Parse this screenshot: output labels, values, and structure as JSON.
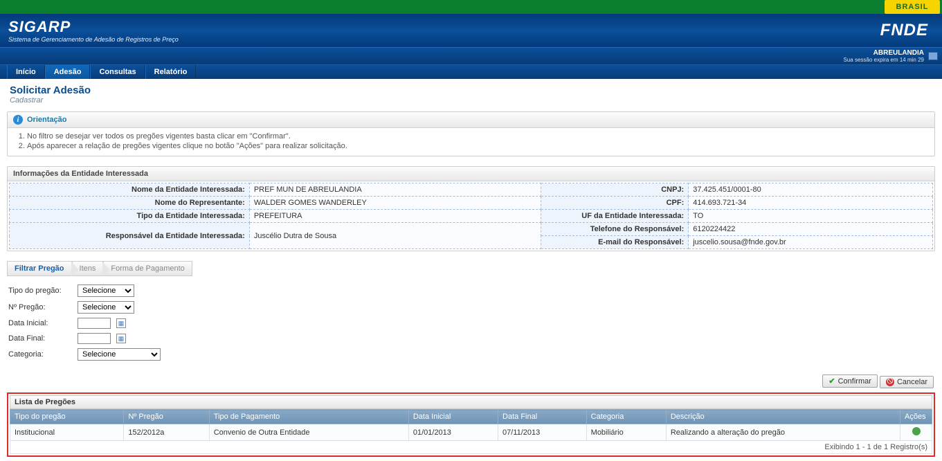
{
  "brasil": "BRASIL",
  "app": {
    "title": "SIGARP",
    "subtitle": "Sistema de Gerenciamento de Adesão de Registros de Preço",
    "logo": "FNDE"
  },
  "user": {
    "name": "ABREULANDIA",
    "session": "Sua sessão expira em 14 min 29"
  },
  "menu": {
    "inicio": "Início",
    "adesao": "Adesão",
    "consultas": "Consultas",
    "relatorio": "Relatório"
  },
  "page": {
    "title": "Solicitar Adesão",
    "subtitle": "Cadastrar"
  },
  "orientacao": {
    "title": "Orientação",
    "items": [
      "No filtro se desejar ver todos os pregões vigentes basta clicar em \"Confirmar\".",
      "Após aparecer a relação de pregões vigentes clique no botão \"Ações\" para realizar solicitação."
    ]
  },
  "entity": {
    "section_title": "Informações da Entidade Interessada",
    "rows": [
      {
        "l1": "Nome da Entidade Interessada:",
        "v1": "PREF MUN DE ABREULANDIA",
        "l2": "CNPJ:",
        "v2": "37.425.451/0001-80"
      },
      {
        "l1": "Nome do Representante:",
        "v1": "WALDER GOMES WANDERLEY",
        "l2": "CPF:",
        "v2": "414.693.721-34"
      },
      {
        "l1": "Tipo da Entidade Interessada:",
        "v1": "PREFEITURA",
        "l2": "UF da Entidade Interessada:",
        "v2": "TO"
      },
      {
        "l1": "Responsável da Entidade Interessada:",
        "v1": "Juscélio Dutra de Sousa",
        "l2": "Telefone do Responsável:",
        "v2": "6120224422",
        "l3": "E-mail do Responsável:",
        "v3": "juscelio.sousa@fnde.gov.br",
        "double": true
      }
    ]
  },
  "steps": {
    "s1": "Filtrar Pregão",
    "s2": "Itens",
    "s3": "Forma de Pagamento"
  },
  "filter": {
    "tipo_pregao_label": "Tipo do pregão:",
    "num_pregao_label": "Nº Pregão:",
    "data_inicial_label": "Data Inicial:",
    "data_final_label": "Data Final:",
    "categoria_label": "Categoria:",
    "selecione": "Selecione"
  },
  "buttons": {
    "confirmar": "Confirmar",
    "cancelar": "Cancelar"
  },
  "list": {
    "title": "Lista de Pregões",
    "cols": {
      "tipo": "Tipo do pregão",
      "num": "Nº Pregão",
      "pag": "Tipo de Pagamento",
      "di": "Data Inicial",
      "df": "Data Final",
      "cat": "Categoria",
      "desc": "Descrição",
      "acoes": "Ações"
    },
    "rows": [
      {
        "tipo": "Institucional",
        "num": "152/2012a",
        "pag": "Convenio de Outra Entidade",
        "di": "01/01/2013",
        "df": "07/11/2013",
        "cat": "Mobiliário",
        "desc": "Realizando a alteração do pregão"
      }
    ],
    "footer": "Exibindo 1 - 1 de 1 Registro(s)"
  }
}
